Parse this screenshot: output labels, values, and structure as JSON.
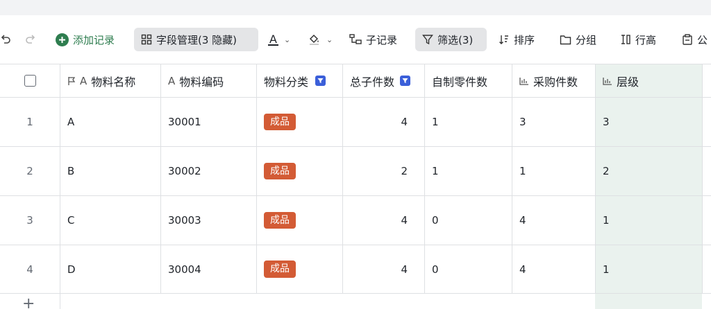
{
  "toolbar": {
    "add_record": "添加记录",
    "field_manage": "字段管理(3 隐藏)",
    "text_color_label": "A",
    "sub_record": "子记录",
    "filter": "筛选(3)",
    "sort": "排序",
    "group": "分组",
    "row_height": "行高",
    "share_partial": "公"
  },
  "table": {
    "headers": {
      "name": "物料名称",
      "code": "物料编码",
      "category": "物料分类",
      "total": "总子件数",
      "self_made": "自制零件数",
      "purchased": "采购件数",
      "level": "层级"
    },
    "rows": [
      {
        "index": "1",
        "name": "A",
        "code": "30001",
        "category": "成品",
        "total": "4",
        "self_made": "1",
        "purchased": "3",
        "level": "3"
      },
      {
        "index": "2",
        "name": "B",
        "code": "30002",
        "category": "成品",
        "total": "2",
        "self_made": "1",
        "purchased": "1",
        "level": "2"
      },
      {
        "index": "3",
        "name": "C",
        "code": "30003",
        "category": "成品",
        "total": "4",
        "self_made": "0",
        "purchased": "4",
        "level": "1"
      },
      {
        "index": "4",
        "name": "D",
        "code": "30004",
        "category": "成品",
        "total": "4",
        "self_made": "0",
        "purchased": "4",
        "level": "1"
      }
    ],
    "add_row_symbol": "+"
  },
  "colors": {
    "tag": "#d35b35",
    "filter_badge": "#3b5fd9",
    "highlight_column": "#eaf2ee",
    "add_icon": "#2e7d4f"
  }
}
